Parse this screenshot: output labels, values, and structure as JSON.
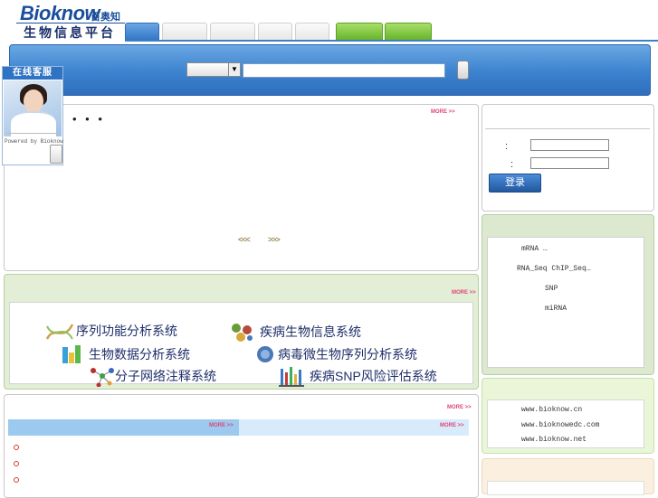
{
  "header": {
    "brand": "Bioknow",
    "brand_cn": "百奥知",
    "platform": "生物信息平台"
  },
  "service_widget": {
    "title": "在线客服",
    "powered": "Powered by Bioknow"
  },
  "main": {
    "more_label": "MORE >>",
    "ellipsis": "• • •",
    "prev_arrows": "<<<",
    "next_arrows": ">>>"
  },
  "systems": [
    {
      "label": "序列功能分析系统",
      "icon": "dna-icon",
      "color": "#c8a24a"
    },
    {
      "label": "疾病生物信息系统",
      "icon": "molecule-icon",
      "color": "#6a9a3a"
    },
    {
      "label": "生物数据分析系统",
      "icon": "bars-icon",
      "color": "#3aa0d8"
    },
    {
      "label": "病毒微生物序列分析系统",
      "icon": "virus-icon",
      "color": "#4a78b8"
    },
    {
      "label": "分子网络注释系统",
      "icon": "network-icon",
      "color": "#b83030"
    },
    {
      "label": "疾病SNP风险评估系统",
      "icon": "snp-icon",
      "color": "#3a78c8"
    }
  ],
  "login": {
    "user_colon": ":",
    "pass_colon": ":",
    "button": "登录"
  },
  "databases": {
    "items": [
      "mRNA        …",
      "RNA_Seq ChIP_Seq…",
      "SNP",
      "miRNA"
    ]
  },
  "links": {
    "items": [
      "www.bioknow.cn",
      "www.bioknowedc.com",
      "www.bioknow.net"
    ]
  },
  "colors": {
    "nav_blue": "#2f74c4",
    "nav_green": "#63b226",
    "more_pink": "#e0447a",
    "system_text": "#1f2f6a"
  }
}
